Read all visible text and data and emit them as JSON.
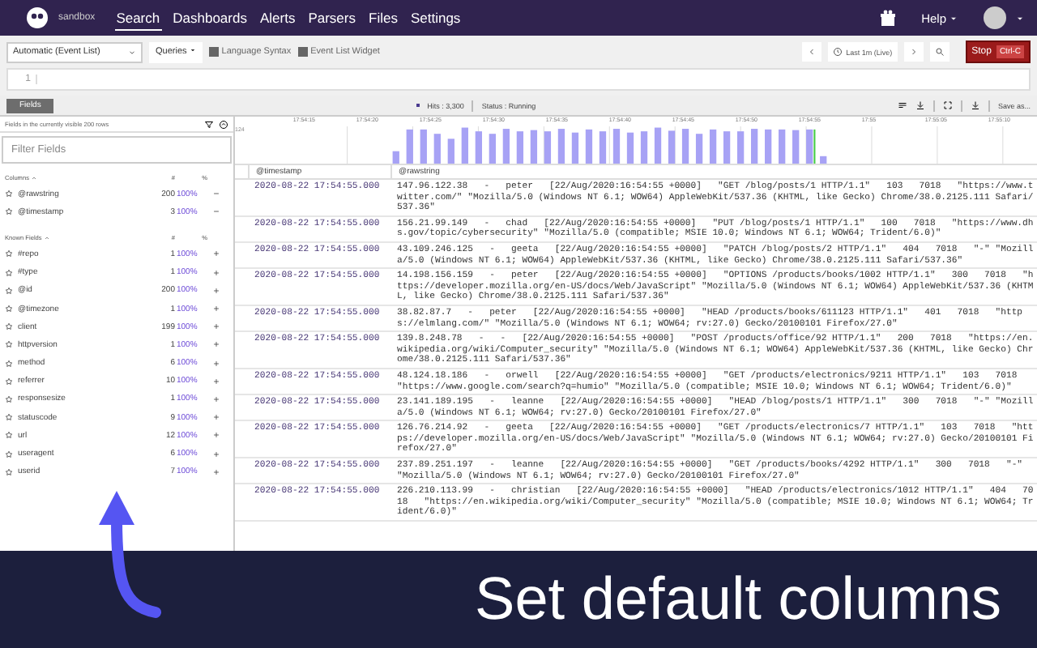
{
  "header": {
    "org": "sandbox",
    "nav": [
      {
        "label": "Search",
        "selected": true
      },
      {
        "label": "Dashboards",
        "selected": false
      },
      {
        "label": "Alerts",
        "selected": false
      },
      {
        "label": "Parsers",
        "selected": false
      },
      {
        "label": "Files",
        "selected": false
      },
      {
        "label": "Settings",
        "selected": false
      }
    ],
    "help": "Help"
  },
  "toolbar": {
    "mode": "Automatic (Event List)",
    "queries": "Queries",
    "links": [
      "Language Syntax",
      "Event List Widget"
    ],
    "time_range": "Last 1m (Live)",
    "stop": "Stop",
    "stop_key": "Ctrl-C"
  },
  "editor": {
    "line_number": "1"
  },
  "results_bar": {
    "tab": "Fields",
    "hits": "Hits : 3,300",
    "status": "Status : Running",
    "save": "Save as..."
  },
  "fields_panel": {
    "note": "Fields in the currently visible 200 rows",
    "filter_placeholder": "Filter Fields",
    "sections": [
      {
        "title": "Columns",
        "kind": "columns",
        "count_header": "#",
        "percent_header": "%",
        "fields": [
          {
            "name": "@rawstring",
            "count": "200",
            "percent": "100%"
          },
          {
            "name": "@timestamp",
            "count": "3",
            "percent": "100%"
          }
        ]
      },
      {
        "title": "Known Fields",
        "kind": "known",
        "count_header": "#",
        "percent_header": "%",
        "fields": [
          {
            "name": "#repo",
            "count": "1",
            "percent": "100%"
          },
          {
            "name": "#type",
            "count": "1",
            "percent": "100%"
          },
          {
            "name": "@id",
            "count": "200",
            "percent": "100%"
          },
          {
            "name": "@timezone",
            "count": "1",
            "percent": "100%"
          },
          {
            "name": "client",
            "count": "199",
            "percent": "100%"
          },
          {
            "name": "httpversion",
            "count": "1",
            "percent": "100%"
          },
          {
            "name": "method",
            "count": "6",
            "percent": "100%"
          },
          {
            "name": "referrer",
            "count": "10",
            "percent": "100%"
          },
          {
            "name": "responsesize",
            "count": "1",
            "percent": "100%"
          },
          {
            "name": "statuscode",
            "count": "9",
            "percent": "100%"
          },
          {
            "name": "url",
            "count": "12",
            "percent": "100%"
          },
          {
            "name": "useragent",
            "count": "6",
            "percent": "100%"
          },
          {
            "name": "userid",
            "count": "7",
            "percent": "100%"
          }
        ]
      }
    ]
  },
  "timeline": {
    "max_label": "124",
    "ticks": [
      "17:54:15",
      "17:54:20",
      "17:54:25",
      "17:54:30",
      "17:54:35",
      "17:54:40",
      "17:54:45",
      "17:54:50",
      "17:54:55",
      "17:55",
      "17:55:05",
      "17:55:10"
    ]
  },
  "table": {
    "columns": [
      "@timestamp",
      "@rawstring"
    ],
    "rows": [
      {
        "timestamp": "2020-08-22 17:54:55.000",
        "rawstring": "147.96.122.38   -   peter   [22/Aug/2020:16:54:55 +0000]   \"GET /blog/posts/1 HTTP/1.1\"   103   7018   \"https://www.twitter.com/\" \"Mozilla/5.0 (Windows NT 6.1; WOW64) AppleWebKit/537.36 (KHTML, like Gecko) Chrome/38.0.2125.111 Safari/537.36\""
      },
      {
        "timestamp": "2020-08-22 17:54:55.000",
        "rawstring": "156.21.99.149   -   chad   [22/Aug/2020:16:54:55 +0000]   \"PUT /blog/posts/1 HTTP/1.1\"   100   7018   \"https://www.dhs.gov/topic/cybersecurity\" \"Mozilla/5.0 (compatible; MSIE 10.0; Windows NT 6.1; WOW64; Trident/6.0)\""
      },
      {
        "timestamp": "2020-08-22 17:54:55.000",
        "rawstring": "43.109.246.125   -   geeta   [22/Aug/2020:16:54:55 +0000]   \"PATCH /blog/posts/2 HTTP/1.1\"   404   7018   \"-\" \"Mozilla/5.0 (Windows NT 6.1; WOW64) AppleWebKit/537.36 (KHTML, like Gecko) Chrome/38.0.2125.111 Safari/537.36\""
      },
      {
        "timestamp": "2020-08-22 17:54:55.000",
        "rawstring": "14.198.156.159   -   peter   [22/Aug/2020:16:54:55 +0000]   \"OPTIONS /products/books/1002 HTTP/1.1\"   300   7018   \"https://developer.mozilla.org/en-US/docs/Web/JavaScript\" \"Mozilla/5.0 (Windows NT 6.1; WOW64) AppleWebKit/537.36 (KHTML, like Gecko) Chrome/38.0.2125.111 Safari/537.36\""
      },
      {
        "timestamp": "2020-08-22 17:54:55.000",
        "rawstring": "38.82.87.7   -   peter   [22/Aug/2020:16:54:55 +0000]   \"HEAD /products/books/611123 HTTP/1.1\"   401   7018   \"https://elmlang.com/\" \"Mozilla/5.0 (Windows NT 6.1; WOW64; rv:27.0) Gecko/20100101 Firefox/27.0\""
      },
      {
        "timestamp": "2020-08-22 17:54:55.000",
        "rawstring": "139.8.248.78   -   -   [22/Aug/2020:16:54:55 +0000]   \"POST /products/office/92 HTTP/1.1\"   200   7018   \"https://en.wikipedia.org/wiki/Computer_security\" \"Mozilla/5.0 (Windows NT 6.1; WOW64) AppleWebKit/537.36 (KHTML, like Gecko) Chrome/38.0.2125.111 Safari/537.36\""
      },
      {
        "timestamp": "2020-08-22 17:54:55.000",
        "rawstring": "48.124.18.186   -   orwell   [22/Aug/2020:16:54:55 +0000]   \"GET /products/electronics/9211 HTTP/1.1\"   103   7018   \"https://www.google.com/search?q=humio\" \"Mozilla/5.0 (compatible; MSIE 10.0; Windows NT 6.1; WOW64; Trident/6.0)\""
      },
      {
        "timestamp": "2020-08-22 17:54:55.000",
        "rawstring": "23.141.189.195   -   leanne   [22/Aug/2020:16:54:55 +0000]   \"HEAD /blog/posts/1 HTTP/1.1\"   300   7018   \"-\" \"Mozilla/5.0 (Windows NT 6.1; WOW64; rv:27.0) Gecko/20100101 Firefox/27.0\""
      },
      {
        "timestamp": "2020-08-22 17:54:55.000",
        "rawstring": "126.76.214.92   -   geeta   [22/Aug/2020:16:54:55 +0000]   \"GET /products/electronics/7 HTTP/1.1\"   103   7018   \"https://developer.mozilla.org/en-US/docs/Web/JavaScript\" \"Mozilla/5.0 (Windows NT 6.1; WOW64; rv:27.0) Gecko/20100101 Firefox/27.0\""
      },
      {
        "timestamp": "2020-08-22 17:54:55.000",
        "rawstring": "237.89.251.197   -   leanne   [22/Aug/2020:16:54:55 +0000]   \"GET /products/books/4292 HTTP/1.1\"   300   7018   \"-\" \"Mozilla/5.0 (Windows NT 6.1; WOW64; rv:27.0) Gecko/20100101 Firefox/27.0\""
      },
      {
        "timestamp": "2020-08-22 17:54:55.000",
        "rawstring": "226.210.113.99   -   christian   [22/Aug/2020:16:54:55 +0000]   \"HEAD /products/electronics/1012 HTTP/1.1\"   404   7018   \"https://en.wikipedia.org/wiki/Computer_security\" \"Mozilla/5.0 (compatible; MSIE 10.0; Windows NT 6.1; WOW64; Trident/6.0)\""
      }
    ]
  },
  "banner": {
    "caption": "Set default columns"
  }
}
